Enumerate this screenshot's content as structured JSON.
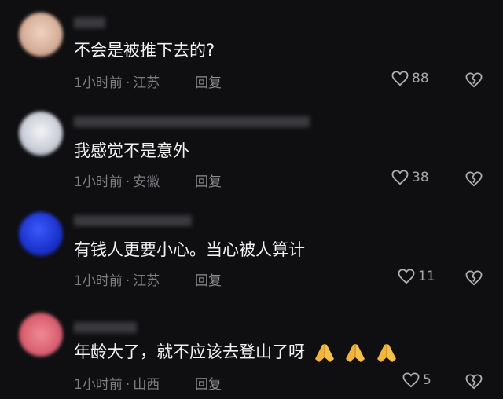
{
  "comments": [
    {
      "username": "",
      "text": "不会是被推下去的?",
      "time": "1小时前",
      "location": "江苏",
      "reply_label": "回复",
      "likes": "88",
      "avatar_color": "#e8c7b4"
    },
    {
      "username": "",
      "text": "我感觉不是意外",
      "time": "1小时前",
      "location": "安徽",
      "reply_label": "回复",
      "likes": "38",
      "avatar_color": "#d7dbe4"
    },
    {
      "username": "",
      "text": "有钱人更要小心。当心被人算计",
      "time": "1小时前",
      "location": "江苏",
      "reply_label": "回复",
      "likes": "11",
      "avatar_color": "#1d3bd8"
    },
    {
      "username": "",
      "text": "年龄大了，就不应该去登山了呀",
      "time": "1小时前",
      "location": "山西",
      "reply_label": "回复",
      "likes": "5",
      "avatar_color": "#e0707e",
      "emoji": [
        "folded-hands-emoji",
        "folded-hands-emoji",
        "folded-hands-emoji"
      ]
    }
  ],
  "separator": "·"
}
